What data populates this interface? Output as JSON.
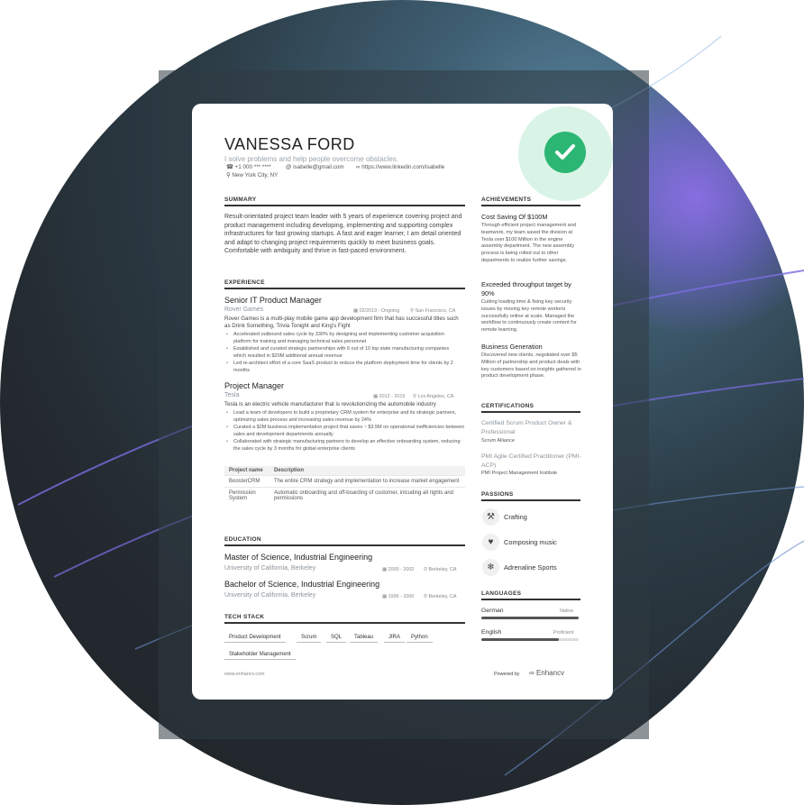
{
  "colors": {
    "accent_green": "#2bb673",
    "check_bg": "#d9f4e6",
    "bg_dark": "#23292f",
    "bg_purple": "#8c6ee6"
  },
  "icons": {
    "verified": "check-circle-icon",
    "phone": "phone-icon",
    "email": "email-icon",
    "link": "link-icon",
    "location": "location-pin-icon",
    "calendar": "calendar-icon",
    "crafting": "tools-icon",
    "composing": "heart-icon",
    "adrenaline": "skier-icon",
    "logo": "enhancv-logo-icon"
  },
  "header": {
    "name": "VANESSA FORD",
    "tagline": "I solve problems and help people overcome obstacles.",
    "phone": "+1 000 *** ****",
    "email": "isabelle@gmail.com",
    "link": "https://www.linkedin.com/isabelle",
    "location": "New York City, NY"
  },
  "summary": {
    "heading": "SUMMARY",
    "text": "Result-orientated project team leader with 5 years of experience covering project and product management including developing, implementing and supporting complex infrastructures for fast growing startups. A fast and eager learner, I am detail oriented and adapt to changing project requirements quickly to meet business goals. Comfortable with ambiguity and thrive in fast-paced environment."
  },
  "experience": {
    "heading": "EXPERIENCE",
    "jobs": [
      {
        "role": "Senior IT Product Manager",
        "company": "Rover Games",
        "dates": "02/2019 - Ongoing",
        "location": "San Francisco, CA",
        "desc": "Rover Games is a multi-play mobile game app development firm that has successful titles such as Drink Something, Trivia Tonight and King's Fight",
        "bullets": [
          "Accelerated outbound sales cycle by 330% by designing and implementing customer acquisition platform for training and managing technical sales personnel",
          "Established and curated strategic partnerships with 6 out of 10 top state manufacturing companies which resulted in $20M additional annual revenue",
          "Led re-architect effort of a core SaaS product to reduce the platform deployment time for clients by 2 months"
        ]
      },
      {
        "role": "Project Manager",
        "company": "Tesla",
        "dates": "2012 - 2019",
        "location": "Los Angeles, CA",
        "desc": "Tesla is an electric vehicle manufacturer that is revolutionizing the automobile industry",
        "bullets": [
          "Lead a team of developers to build a proprietary CRM system for enterprise and its strategic partners, optimizing sales process and increasing sales revenue by 24%",
          "Curated a $2M business implementation project that saves ~ $3.5M on operational inefficiencies between sales and development departments annually",
          "Collaborated with strategic manufacturing partners to develop an effective onboarding system, reducing the sales cycle by 3 months for global enterprise clients"
        ]
      }
    ],
    "table": {
      "headers": [
        "Project name",
        "Description"
      ],
      "rows": [
        [
          "BoosterCRM",
          "The entire CRM strategy and implementation to increase market engagement"
        ],
        [
          "Permission System",
          "Automatic onboarding and off-boarding of customer, inlcuding all rights and permissions"
        ]
      ]
    }
  },
  "education": {
    "heading": "EDUCATION",
    "items": [
      {
        "degree": "Master of Science, Industrial Engineering",
        "school": "University of California, Berkeley",
        "dates": "2000 - 2002",
        "location": "Berkeley, CA"
      },
      {
        "degree": "Bachelor of Science, Industrial Engineering",
        "school": "University of California, Berkeley",
        "dates": "1996 - 2000",
        "location": "Berkeley, CA"
      }
    ]
  },
  "tech_stack": {
    "heading": "TECH STACK",
    "tags": [
      "Product Development",
      "Scrum",
      "SQL",
      "Tableau",
      "JIRA",
      "Python",
      "Stakeholder Management"
    ]
  },
  "achievements": {
    "heading": "ACHIEVEMENTS",
    "items": [
      {
        "title": "Cost Saving Of $100M",
        "text": "Through efficient project management and teamwork, my team saved the division at Tesla over $100 Million in the engine assembly department. The new assembly process is being rolled out to other departments to realize further savings."
      },
      {
        "title": "Exceeded throughput target by 90%",
        "text": "Cutting loading time & fixing key security issues by moving key remote workers successfully online at scale. Managed the workflow to continuously create content for remote learning."
      },
      {
        "title": "Business Generation",
        "text": "Discovered new clients, negotiated over $5 Million of partnership and product deals with key customers based on insights gathered in product development phase."
      }
    ]
  },
  "certifications": {
    "heading": "CERTIFICATIONS",
    "items": [
      {
        "name": "Certified Scrum Product Owner & Professional",
        "issuer": "Scrum Alliance"
      },
      {
        "name": "PMI Agile Certified Practitioner (PMI-ACP)",
        "issuer": "PMI Project Management Institute"
      }
    ]
  },
  "passions": {
    "heading": "PASSIONS",
    "items": [
      "Crafting",
      "Composing music",
      "Adrenaline Sports"
    ]
  },
  "languages": {
    "heading": "LANGUAGES",
    "items": [
      {
        "name": "German",
        "level": "Native",
        "proficiency": 1.0
      },
      {
        "name": "English",
        "level": "Proficient",
        "proficiency": 0.8
      }
    ]
  },
  "footer": {
    "website": "www.enhancv.com",
    "powered_by": "Powered by",
    "brand": "Enhancv"
  }
}
